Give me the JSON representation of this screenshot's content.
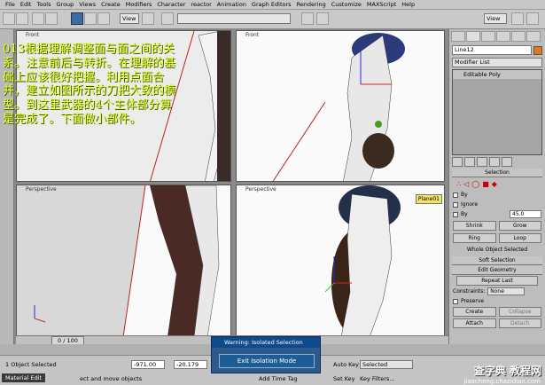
{
  "menu": [
    "File",
    "Edit",
    "Tools",
    "Group",
    "Views",
    "Create",
    "Modifiers",
    "Character",
    "reactor",
    "Animation",
    "Graph Editors",
    "Rendering",
    "Customize",
    "MAXScript",
    "Help"
  ],
  "toolbar": {
    "view1": "View",
    "view2": "View"
  },
  "viewports": {
    "tl": "Front",
    "tr": "Front",
    "bl": "Perspective",
    "br": "Perspective",
    "br_tag": "Plane01"
  },
  "overlay_text": "013根据理解调整面与面之间的关系。注意前后与转折。在理解的基础上应该很好把握。利用点面合并，建立如图所示的刀把大致的模型。到这里武器的4个主体部分算是完成了。下面做小部件。",
  "cmd": {
    "object_name": "Line12",
    "modifier_list": "Modifier List",
    "stack_item": "Editable Poly",
    "selection": "Selection",
    "by_vertex": "By",
    "ignore": "Ignore",
    "by_angle": "By",
    "angle_value": "45.0",
    "shrink": "Shrink",
    "grow": "Grow",
    "ring": "Ring",
    "loop": "Loop",
    "whole_obj": "Whole Object Selected",
    "soft_sel": "Soft Selection",
    "edit_geom": "Edit Geometry",
    "repeat_last": "Repeat Last",
    "constraints": "Constraints:",
    "constraint_val": "None",
    "preserve": "Preserve",
    "create": "Create",
    "collapse": "Collapse",
    "attach": "Attach",
    "detach": "Detach"
  },
  "timeline": {
    "frame": "0 / 100"
  },
  "status": {
    "sel": "1 Object Selected",
    "x": "-971.00",
    "y": "-20.179",
    "prompt": "ect and move objects",
    "add_tag": "Add Time Tag",
    "autokey": "Auto Key",
    "selected": "Selected",
    "setkey": "Set Key",
    "keyfilters": "Key Filters...",
    "mat": "Material Edit"
  },
  "dialog": {
    "title": "Warning: Isolated Selection",
    "button": "Exit Isolation Mode"
  },
  "watermark": {
    "line1": "查字典 教程网",
    "line2": "jiaocheng.chazidian.com"
  }
}
